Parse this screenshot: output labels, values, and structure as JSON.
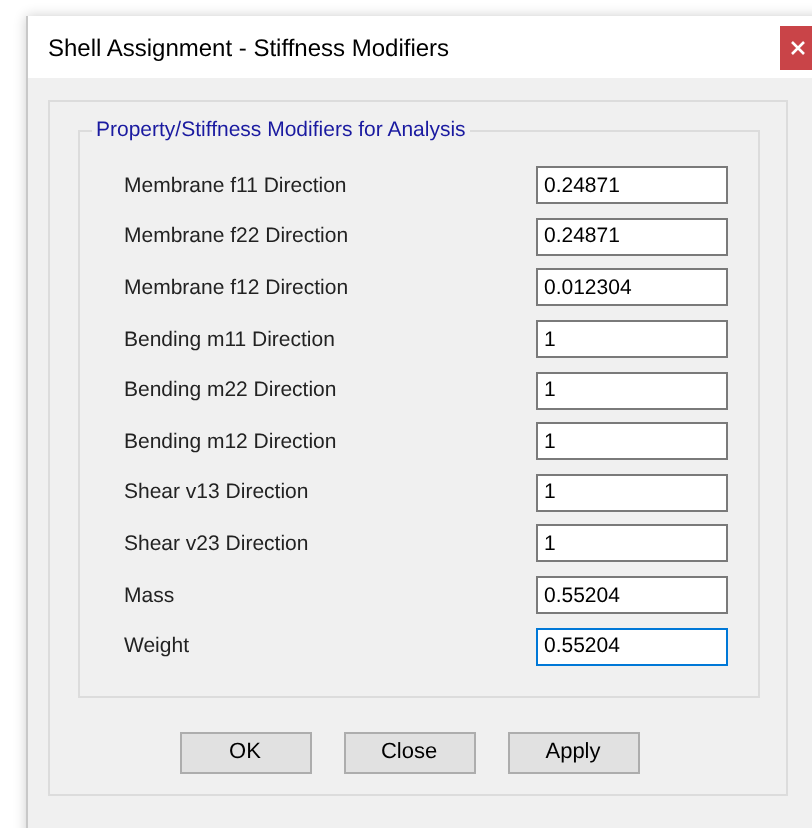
{
  "window": {
    "title": "Shell Assignment - Stiffness Modifiers"
  },
  "group": {
    "title": "Property/Stiffness Modifiers for Analysis"
  },
  "fields": [
    {
      "label": "Membrane f11 Direction",
      "value": "0.24871",
      "focused": false
    },
    {
      "label": "Membrane f22 Direction",
      "value": "0.24871",
      "focused": false
    },
    {
      "label": "Membrane f12 Direction",
      "value": "0.012304",
      "focused": false
    },
    {
      "label": "Bending m11 Direction",
      "value": "1",
      "focused": false
    },
    {
      "label": "Bending m22 Direction",
      "value": "1",
      "focused": false
    },
    {
      "label": "Bending m12 Direction",
      "value": "1",
      "focused": false
    },
    {
      "label": "Shear v13 Direction",
      "value": "1",
      "focused": false
    },
    {
      "label": "Shear v23 Direction",
      "value": "1",
      "focused": false
    },
    {
      "label": "Mass",
      "value": "0.55204",
      "focused": false
    },
    {
      "label": "Weight",
      "value": "0.55204",
      "focused": true
    }
  ],
  "buttons": [
    "OK",
    "Close",
    "Apply"
  ]
}
